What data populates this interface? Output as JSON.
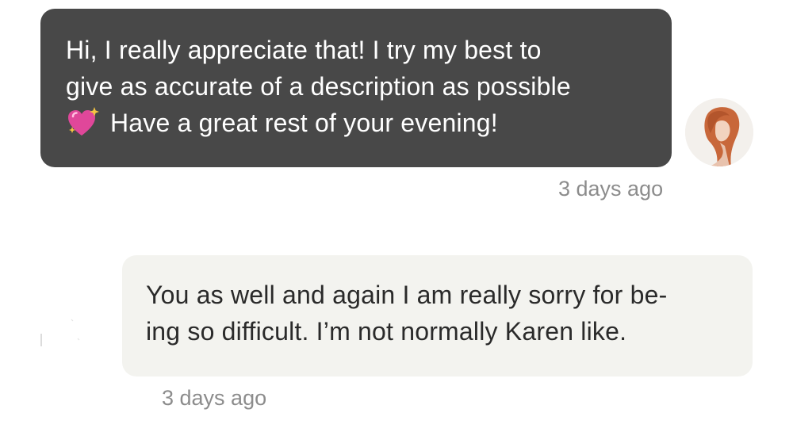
{
  "conversation": {
    "messages": [
      {
        "sender": "self",
        "lines": [
          "Hi, I really appreciate that! I try my best to",
          "give as accurate of a description as possible",
          "Have a great rest of your evening!"
        ],
        "emoji": "sparkling-heart-icon",
        "timestamp": "3 days ago"
      },
      {
        "sender": "other",
        "lines": [
          "You as well and again I am really sorry for be-",
          "ing so difficult. I’m not normally Karen like."
        ],
        "timestamp": "3 days ago"
      }
    ]
  },
  "colors": {
    "outgoing_bubble": "#484848",
    "incoming_bubble": "#f3f3ef",
    "timestamp_text": "#8c8c8c",
    "emoji_heart": "#e0479a",
    "emoji_sparkle": "#f5c542"
  }
}
